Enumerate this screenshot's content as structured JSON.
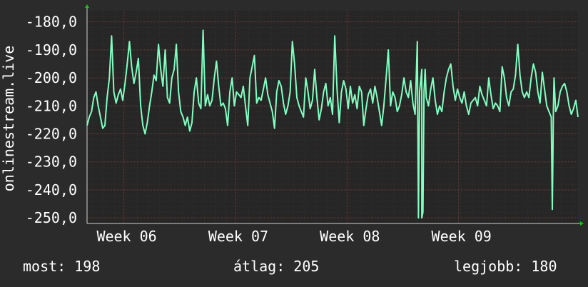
{
  "chart_data": {
    "type": "line",
    "ylabel": "onlinestream.live",
    "y_ticks": [
      "-180,0",
      "-190,0",
      "-200,0",
      "-210,0",
      "-220,0",
      "-230,0",
      "-240,0",
      "-250,0"
    ],
    "y_tick_values": [
      -180,
      -190,
      -200,
      -210,
      -220,
      -230,
      -240,
      -250
    ],
    "ylim": [
      -252,
      -176
    ],
    "x_ticks": [
      "Week 06",
      "Week 07",
      "Week 08",
      "Week 09"
    ],
    "x_tick_positions": [
      1.8,
      11.8,
      21.8,
      31.8
    ],
    "xlim": [
      -1.5,
      42.5
    ],
    "grid": true,
    "colors": {
      "line": "#80ffc0",
      "grid": "#6b3a3a",
      "axis": "#d0d0d0",
      "background": "#2b2b2b",
      "plot_bg": "#262626",
      "arrow": "#00cc00"
    },
    "series": [
      {
        "values": [
          [
            -1.5,
            -217
          ],
          [
            -1.3,
            -214
          ],
          [
            -1.1,
            -212
          ],
          [
            -0.9,
            -207
          ],
          [
            -0.7,
            -205
          ],
          [
            -0.5,
            -210
          ],
          [
            -0.3,
            -214
          ],
          [
            -0.1,
            -218
          ],
          [
            0.1,
            -217
          ],
          [
            0.3,
            -207
          ],
          [
            0.5,
            -200
          ],
          [
            0.7,
            -185
          ],
          [
            0.9,
            -205
          ],
          [
            1.1,
            -209
          ],
          [
            1.3,
            -206
          ],
          [
            1.5,
            -204
          ],
          [
            1.7,
            -208
          ],
          [
            1.9,
            -202
          ],
          [
            2.1,
            -195
          ],
          [
            2.3,
            -187
          ],
          [
            2.5,
            -196
          ],
          [
            2.7,
            -202
          ],
          [
            2.9,
            -198
          ],
          [
            3.1,
            -193
          ],
          [
            3.3,
            -210
          ],
          [
            3.5,
            -217
          ],
          [
            3.7,
            -220
          ],
          [
            3.9,
            -216
          ],
          [
            4.1,
            -210
          ],
          [
            4.3,
            -205
          ],
          [
            4.5,
            -199
          ],
          [
            4.7,
            -201
          ],
          [
            4.9,
            -188
          ],
          [
            5.1,
            -197
          ],
          [
            5.3,
            -203
          ],
          [
            5.5,
            -190
          ],
          [
            5.7,
            -207
          ],
          [
            5.9,
            -209
          ],
          [
            6.1,
            -200
          ],
          [
            6.3,
            -197
          ],
          [
            6.5,
            -188
          ],
          [
            6.7,
            -205
          ],
          [
            6.9,
            -212
          ],
          [
            7.1,
            -214
          ],
          [
            7.3,
            -217
          ],
          [
            7.5,
            -214
          ],
          [
            7.7,
            -219
          ],
          [
            7.9,
            -216
          ],
          [
            8.1,
            -205
          ],
          [
            8.3,
            -200
          ],
          [
            8.5,
            -209
          ],
          [
            8.7,
            -211
          ],
          [
            8.9,
            -183
          ],
          [
            9.1,
            -210
          ],
          [
            9.3,
            -206
          ],
          [
            9.5,
            -210
          ],
          [
            9.7,
            -208
          ],
          [
            9.9,
            -200
          ],
          [
            10.1,
            -194
          ],
          [
            10.3,
            -203
          ],
          [
            10.5,
            -210
          ],
          [
            10.7,
            -209
          ],
          [
            10.9,
            -211
          ],
          [
            11.1,
            -217
          ],
          [
            11.3,
            -205
          ],
          [
            11.5,
            -200
          ],
          [
            11.7,
            -210
          ],
          [
            11.9,
            -205
          ],
          [
            12.1,
            -206
          ],
          [
            12.3,
            -207
          ],
          [
            12.5,
            -203
          ],
          [
            12.7,
            -210
          ],
          [
            12.9,
            -217
          ],
          [
            13.1,
            -200
          ],
          [
            13.3,
            -196
          ],
          [
            13.5,
            -192
          ],
          [
            13.7,
            -209
          ],
          [
            13.9,
            -207
          ],
          [
            14.1,
            -208
          ],
          [
            14.3,
            -204
          ],
          [
            14.5,
            -200
          ],
          [
            14.7,
            -206
          ],
          [
            14.9,
            -209
          ],
          [
            15.1,
            -212
          ],
          [
            15.3,
            -218
          ],
          [
            15.5,
            -205
          ],
          [
            15.7,
            -201
          ],
          [
            15.9,
            -203
          ],
          [
            16.1,
            -209
          ],
          [
            16.3,
            -213
          ],
          [
            16.5,
            -210
          ],
          [
            16.7,
            -205
          ],
          [
            16.9,
            -187
          ],
          [
            17.1,
            -195
          ],
          [
            17.3,
            -207
          ],
          [
            17.5,
            -210
          ],
          [
            17.7,
            -212
          ],
          [
            17.9,
            -214
          ],
          [
            18.1,
            -200
          ],
          [
            18.3,
            -205
          ],
          [
            18.5,
            -211
          ],
          [
            18.7,
            -208
          ],
          [
            18.9,
            -197
          ],
          [
            19.1,
            -207
          ],
          [
            19.3,
            -215
          ],
          [
            19.5,
            -211
          ],
          [
            19.7,
            -205
          ],
          [
            19.9,
            -202
          ],
          [
            20.1,
            -210
          ],
          [
            20.3,
            -207
          ],
          [
            20.5,
            -213
          ],
          [
            20.7,
            -185
          ],
          [
            20.9,
            -204
          ],
          [
            21.1,
            -216
          ],
          [
            21.3,
            -205
          ],
          [
            21.5,
            -201
          ],
          [
            21.7,
            -204
          ],
          [
            21.9,
            -211
          ],
          [
            22.1,
            -203
          ],
          [
            22.3,
            -209
          ],
          [
            22.5,
            -206
          ],
          [
            22.7,
            -211
          ],
          [
            22.9,
            -203
          ],
          [
            23.1,
            -205
          ],
          [
            23.3,
            -217
          ],
          [
            23.5,
            -211
          ],
          [
            23.7,
            -206
          ],
          [
            23.9,
            -204
          ],
          [
            24.1,
            -209
          ],
          [
            24.3,
            -203
          ],
          [
            24.5,
            -207
          ],
          [
            24.7,
            -212
          ],
          [
            24.9,
            -217
          ],
          [
            25.1,
            -210
          ],
          [
            25.3,
            -200
          ],
          [
            25.5,
            -190
          ],
          [
            25.7,
            -210
          ],
          [
            25.9,
            -205
          ],
          [
            26.1,
            -207
          ],
          [
            26.3,
            -212
          ],
          [
            26.5,
            -210
          ],
          [
            26.7,
            -206
          ],
          [
            26.9,
            -200
          ],
          [
            27.1,
            -205
          ],
          [
            27.3,
            -207
          ],
          [
            27.5,
            -201
          ],
          [
            27.7,
            -209
          ],
          [
            27.9,
            -213
          ],
          [
            28.1,
            -187
          ],
          [
            28.3,
            -205
          ],
          [
            28.5,
            -197
          ],
          [
            28.7,
            -205
          ],
          [
            28.9,
            -207
          ],
          [
            29.1,
            -210
          ],
          [
            29.3,
            -204
          ],
          [
            29.5,
            -200
          ],
          [
            29.7,
            -208
          ],
          [
            29.9,
            -213
          ],
          [
            30.1,
            -210
          ],
          [
            30.3,
            -212
          ],
          [
            30.5,
            -205
          ],
          [
            30.7,
            -200
          ],
          [
            30.9,
            -197
          ],
          [
            31.1,
            -195
          ],
          [
            31.3,
            -203
          ],
          [
            31.5,
            -208
          ],
          [
            31.7,
            -204
          ],
          [
            31.9,
            -207
          ],
          [
            32.1,
            -209
          ],
          [
            32.3,
            -205
          ],
          [
            32.5,
            -210
          ],
          [
            32.7,
            -213
          ],
          [
            32.9,
            -209
          ],
          [
            33.1,
            -208
          ],
          [
            33.3,
            -207
          ],
          [
            33.5,
            -210
          ],
          [
            33.7,
            -203
          ],
          [
            33.9,
            -206
          ],
          [
            34.1,
            -208
          ],
          [
            34.3,
            -210
          ],
          [
            34.5,
            -200
          ],
          [
            34.7,
            -206
          ],
          [
            34.9,
            -211
          ],
          [
            35.1,
            -209
          ],
          [
            35.3,
            -210
          ],
          [
            35.5,
            -212
          ],
          [
            35.7,
            -196
          ],
          [
            35.9,
            -200
          ],
          [
            36.1,
            -207
          ],
          [
            36.3,
            -210
          ],
          [
            36.5,
            -205
          ],
          [
            36.7,
            -204
          ],
          [
            36.9,
            -199
          ],
          [
            37.1,
            -188
          ],
          [
            37.3,
            -199
          ],
          [
            37.5,
            -205
          ],
          [
            37.7,
            -207
          ],
          [
            37.9,
            -205
          ],
          [
            38.1,
            -207
          ],
          [
            38.3,
            -200
          ],
          [
            38.5,
            -195
          ],
          [
            38.7,
            -198
          ],
          [
            38.9,
            -205
          ],
          [
            39.1,
            -209
          ],
          [
            39.3,
            -198
          ],
          [
            39.5,
            -204
          ],
          [
            39.7,
            -210
          ],
          [
            39.9,
            -212
          ],
          [
            40.1,
            -214
          ],
          [
            40.3,
            -210
          ],
          [
            40.5,
            -212
          ],
          [
            40.7,
            -210
          ],
          [
            40.9,
            -205
          ],
          [
            41.1,
            -203
          ],
          [
            41.3,
            -202
          ],
          [
            41.5,
            -205
          ],
          [
            41.7,
            -210
          ],
          [
            41.9,
            -213
          ],
          [
            42.1,
            -211
          ],
          [
            42.3,
            -208
          ],
          [
            42.5,
            -214
          ]
        ],
        "spikes": [
          [
            28.1,
            -187
          ],
          [
            28.2,
            -250
          ],
          [
            28.5,
            -250
          ],
          [
            28.6,
            -248
          ],
          [
            28.8,
            -197
          ],
          [
            40.2,
            -247
          ],
          [
            40.35,
            -200
          ]
        ]
      }
    ]
  },
  "stats": {
    "current": "most: 198",
    "average": "átlag: 205",
    "best": "legjobb: 180"
  }
}
